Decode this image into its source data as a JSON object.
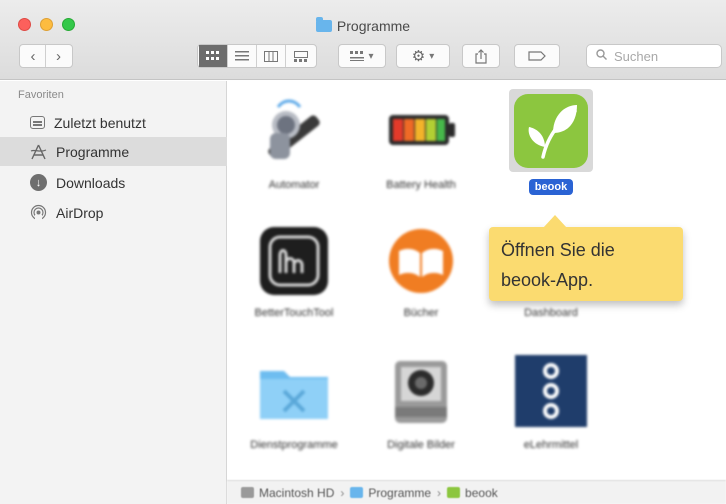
{
  "window": {
    "title": "Programme"
  },
  "toolbar": {
    "back_label": "‹",
    "forward_label": "›",
    "view_icons": [
      "icon-view",
      "list-view",
      "column-view",
      "gallery-view"
    ],
    "group_label": "▾",
    "action_label": "▾",
    "search_placeholder": "Suchen"
  },
  "sidebar": {
    "heading": "Favoriten",
    "items": [
      {
        "label": "Zuletzt benutzt",
        "icon": "recents-icon"
      },
      {
        "label": "Programme",
        "icon": "applications-icon",
        "selected": true
      },
      {
        "label": "Downloads",
        "icon": "downloads-icon"
      },
      {
        "label": "AirDrop",
        "icon": "airdrop-icon"
      }
    ]
  },
  "apps": [
    {
      "label": "Automator",
      "icon": "automator-icon"
    },
    {
      "label": "Battery Health",
      "icon": "battery-icon"
    },
    {
      "label": "beook",
      "icon": "beook-icon",
      "selected": true
    },
    {
      "label": "BetterTouchTool",
      "icon": "bettertouchtool-icon"
    },
    {
      "label": "Bücher",
      "icon": "books-icon"
    },
    {
      "label": "Dashboard",
      "icon": "dashboard-icon"
    },
    {
      "label": "Dienstprogramme",
      "icon": "utilities-folder-icon"
    },
    {
      "label": "Digitale Bilder",
      "icon": "image-capture-icon"
    },
    {
      "label": "eLehrmittel",
      "icon": "elehrmittel-icon"
    }
  ],
  "tooltip": {
    "line1": "Öffnen Sie die",
    "line2": "beook-App."
  },
  "pathbar": {
    "items": [
      "Macintosh HD",
      "Programme",
      "beook"
    ],
    "separator": "›"
  },
  "colors": {
    "selection": "#2a63d4",
    "tooltip": "#fbdb70",
    "beook_green": "#8cc63f"
  }
}
